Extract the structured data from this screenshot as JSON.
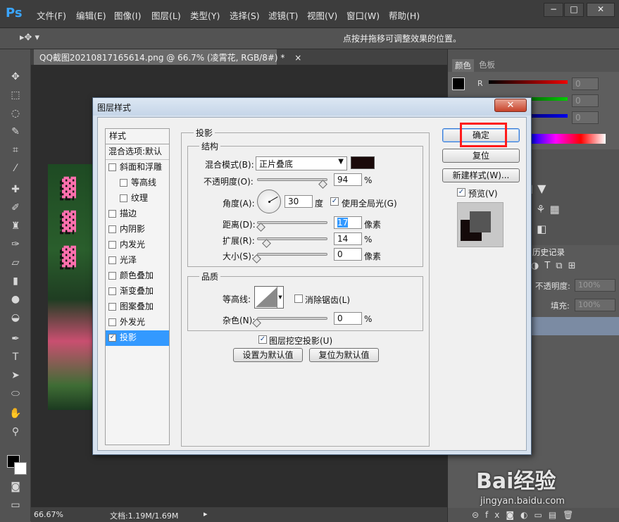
{
  "app": {
    "logo": "Ps",
    "menu": [
      "文件(F)",
      "编辑(E)",
      "图像(I)",
      "图层(L)",
      "类型(Y)",
      "选择(S)",
      "滤镜(T)",
      "视图(V)",
      "窗口(W)",
      "帮助(H)"
    ],
    "window_buttons": [
      "−",
      "□",
      "✕"
    ]
  },
  "options_bar": {
    "hint": "点按并拖移可调整效果的位置。"
  },
  "document": {
    "tab_title": "QQ截图20210817165614.png @ 66.7% (凌霄花, RGB/8#) *",
    "tab_close": "×"
  },
  "status_bar": {
    "zoom": "66.67%",
    "doc_info": "文档:1.19M/1.69M"
  },
  "right_panels": {
    "color_tabs": [
      "颜色",
      "色板"
    ],
    "channel_label": "R",
    "channel_values": [
      "0",
      "0",
      "0"
    ],
    "history_tab": "历史记录",
    "opacity_label": "不透明度:",
    "opacity_value": "100%",
    "fill_label": "填充:",
    "fill_value": "100%"
  },
  "dialog": {
    "title": "图层样式",
    "close": "✕",
    "style_list": {
      "header": "样式",
      "blend_options": "混合选项:默认",
      "items": [
        {
          "label": "斜面和浮雕",
          "checked": false,
          "indent": false
        },
        {
          "label": "等高线",
          "checked": false,
          "indent": true
        },
        {
          "label": "纹理",
          "checked": false,
          "indent": true
        },
        {
          "label": "描边",
          "checked": false,
          "indent": false
        },
        {
          "label": "内阴影",
          "checked": false,
          "indent": false
        },
        {
          "label": "内发光",
          "checked": false,
          "indent": false
        },
        {
          "label": "光泽",
          "checked": false,
          "indent": false
        },
        {
          "label": "颜色叠加",
          "checked": false,
          "indent": false
        },
        {
          "label": "渐变叠加",
          "checked": false,
          "indent": false
        },
        {
          "label": "图案叠加",
          "checked": false,
          "indent": false
        },
        {
          "label": "外发光",
          "checked": false,
          "indent": false
        },
        {
          "label": "投影",
          "checked": true,
          "indent": false,
          "selected": true
        }
      ]
    },
    "section_title": "投影",
    "structure": {
      "title": "结构",
      "blend_mode_label": "混合模式(B):",
      "blend_mode_value": "正片叠底",
      "shadow_color": "#1a0a0a",
      "opacity_label": "不透明度(O):",
      "opacity_value": "94",
      "opacity_unit": "%",
      "opacity_level": 0.94,
      "angle_label": "角度(A):",
      "angle_value": "30",
      "angle_unit": "度",
      "global_light_label": "使用全局光(G)",
      "global_light_checked": true,
      "distance_label": "距离(D):",
      "distance_value": "17",
      "distance_unit": "像素",
      "distance_level": 0.06,
      "spread_label": "扩展(R):",
      "spread_value": "14",
      "spread_unit": "%",
      "spread_level": 0.14,
      "size_label": "大小(S):",
      "size_value": "0",
      "size_unit": "像素",
      "size_level": 0.0
    },
    "quality": {
      "title": "品质",
      "contour_label": "等高线:",
      "antialias_label": "消除锯齿(L)",
      "antialias_checked": false,
      "noise_label": "杂色(N):",
      "noise_value": "0",
      "noise_unit": "%",
      "noise_level": 0.0
    },
    "knockout_label": "图层挖空投影(U)",
    "knockout_checked": true,
    "set_default_label": "设置为默认值",
    "reset_default_label": "复位为默认值",
    "buttons": {
      "ok": "确定",
      "reset": "复位",
      "new_style": "新建样式(W)...",
      "preview_label": "预览(V)",
      "preview_checked": true
    }
  },
  "watermark": {
    "brand": "Bai经验",
    "url": "jingyan.baidu.com"
  },
  "colors": {
    "selection": "#3399ff",
    "highlight_box": "#ff1a1a"
  }
}
